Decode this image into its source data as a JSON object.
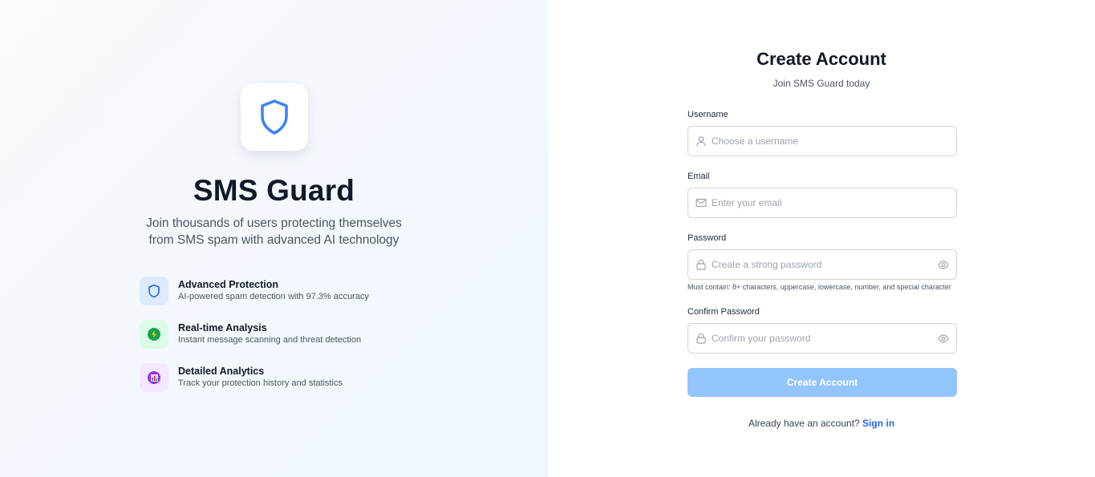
{
  "brand": {
    "name": "SMS Guard",
    "tagline": "Join thousands of users protecting themselves from SMS spam with advanced AI technology"
  },
  "features": [
    {
      "icon": "shield-icon",
      "title": "Advanced Protection",
      "description": "AI-powered spam detection with 97.3% accuracy",
      "color": "#3b82f6"
    },
    {
      "icon": "lightning-icon",
      "title": "Real-time Analysis",
      "description": "Instant message scanning and threat detection",
      "color": "#16a34a"
    },
    {
      "icon": "chart-icon",
      "title": "Detailed Analytics",
      "description": "Track your protection history and statistics",
      "color": "#9333ea"
    }
  ],
  "form": {
    "title": "Create Account",
    "subtitle": "Join SMS Guard today",
    "username": {
      "label": "Username",
      "placeholder": "Choose a username",
      "value": ""
    },
    "email": {
      "label": "Email",
      "placeholder": "Enter your email",
      "value": ""
    },
    "password": {
      "label": "Password",
      "placeholder": "Create a strong password",
      "value": "",
      "hint": "Must contain: 8+ characters, uppercase, lowercase, number, and special character"
    },
    "confirm_password": {
      "label": "Confirm Password",
      "placeholder": "Confirm your password",
      "value": ""
    },
    "submit_label": "Create Account",
    "signin_prompt": "Already have an account?",
    "signin_link": "Sign in"
  },
  "colors": {
    "accent": "#2563eb",
    "submit_disabled": "#93c5fd",
    "shield": "#3b82f6"
  }
}
